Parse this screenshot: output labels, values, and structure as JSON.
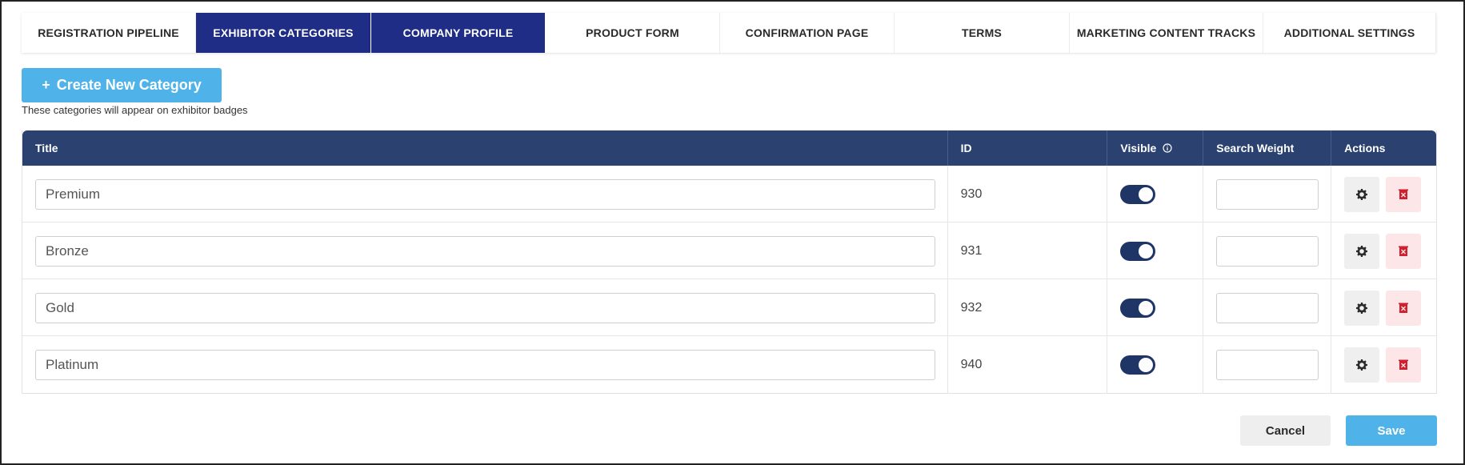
{
  "tabs": [
    {
      "label": "REGISTRATION PIPELINE",
      "active": false
    },
    {
      "label": "EXHIBITOR CATEGORIES",
      "active": true
    },
    {
      "label": "COMPANY PROFILE",
      "active": true
    },
    {
      "label": "PRODUCT FORM",
      "active": false
    },
    {
      "label": "CONFIRMATION PAGE",
      "active": false
    },
    {
      "label": "TERMS",
      "active": false
    },
    {
      "label": "MARKETING CONTENT TRACKS",
      "active": false
    },
    {
      "label": "ADDITIONAL SETTINGS",
      "active": false
    }
  ],
  "create_button": {
    "icon": "plus-icon",
    "label": "Create New Category"
  },
  "hint": "These categories will appear on exhibitor badges",
  "table": {
    "headers": {
      "title": "Title",
      "id": "ID",
      "visible": "Visible",
      "search_weight": "Search Weight",
      "actions": "Actions"
    },
    "rows": [
      {
        "title": "Premium",
        "id": "930",
        "visible": true,
        "search_weight": ""
      },
      {
        "title": "Bronze",
        "id": "931",
        "visible": true,
        "search_weight": ""
      },
      {
        "title": "Gold",
        "id": "932",
        "visible": true,
        "search_weight": ""
      },
      {
        "title": "Platinum",
        "id": "940",
        "visible": true,
        "search_weight": ""
      }
    ]
  },
  "footer": {
    "cancel_label": "Cancel",
    "save_label": "Save"
  },
  "colors": {
    "active_tab": "#1f2d86",
    "table_header": "#2b416f",
    "accent": "#4fb3ea",
    "toggle_on": "#1e3566",
    "delete": "#d0202e"
  }
}
